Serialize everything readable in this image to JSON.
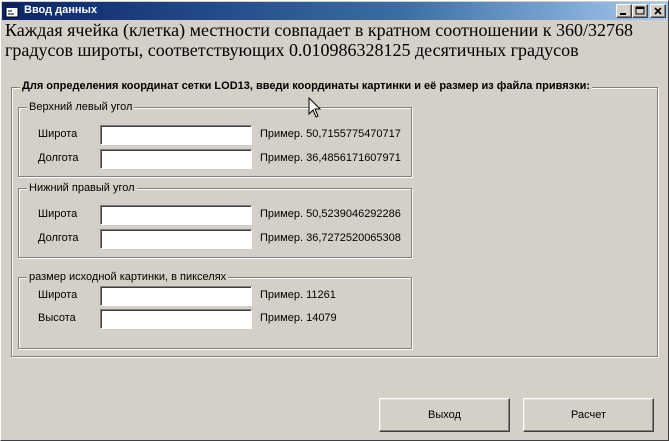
{
  "window": {
    "title": "Ввод данных",
    "icon": "app-form-icon",
    "controls": [
      "minimize-icon",
      "maximize-icon",
      "close-icon"
    ]
  },
  "heading": "Каждая ячейка (клетка) местности совпадает в кратном соотношении к 360/32768 градусов широты, соответствующих 0.010986328125 десятичных градусов",
  "outer_group": {
    "legend": "Для определения координат сетки LOD13, введи координаты картинки и её размер из файла привязки:"
  },
  "groups": [
    {
      "legend": "Верхний левый угол",
      "rows": [
        {
          "label": "Широта",
          "value": "",
          "example": "Пример. 50,7155775470717"
        },
        {
          "label": "Долгота",
          "value": "",
          "example": "Пример. 36,4856171607971"
        }
      ]
    },
    {
      "legend": "Нижний правый угол",
      "rows": [
        {
          "label": "Широта",
          "value": "",
          "example": "Пример. 50,5239046292286"
        },
        {
          "label": "Долгота",
          "value": "",
          "example": "Пример. 36,7272520065308"
        }
      ]
    },
    {
      "legend": "размер исходной картинки, в пикселях",
      "rows": [
        {
          "label": "Широта",
          "value": "",
          "example": "Пример. 11261"
        },
        {
          "label": "Высота",
          "value": "",
          "example": "Пример. 14079"
        }
      ]
    }
  ],
  "buttons": {
    "exit": "Выход",
    "calc": "Расчет"
  }
}
